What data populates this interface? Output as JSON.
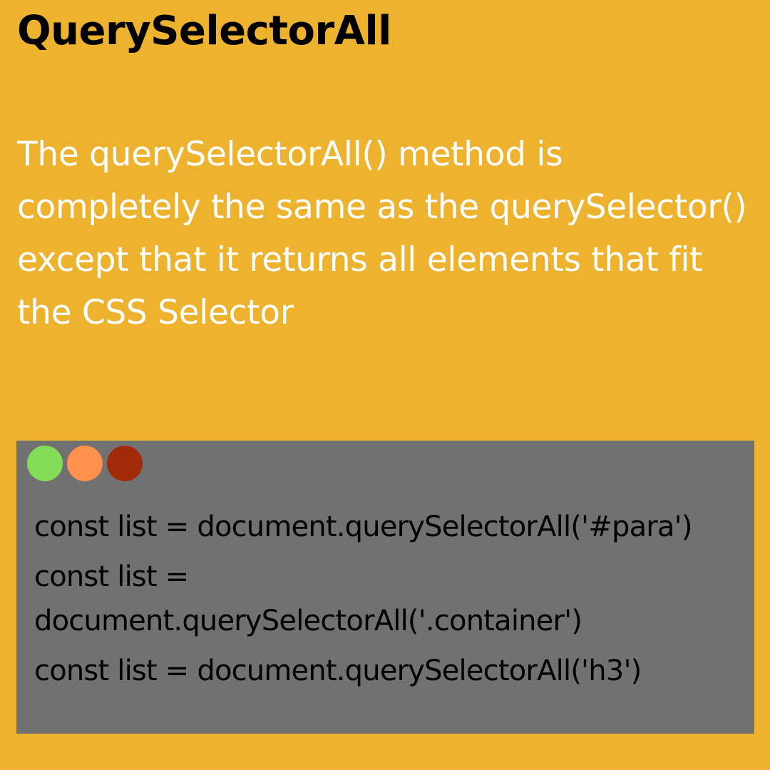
{
  "title": "QuerySelectorAll",
  "description": "The querySelectorAll() method is completely the same as the querySelector() except that it returns all elements that fit the CSS Selector",
  "colors": {
    "background": "#EDB22E",
    "code_background": "#717171",
    "dot_green": "#84DC58",
    "dot_orange": "#FF914D",
    "dot_red": "#A12A08"
  },
  "window_controls": [
    {
      "name": "green-dot-icon",
      "color": "#84DC58"
    },
    {
      "name": "orange-dot-icon",
      "color": "#FF914D"
    },
    {
      "name": "red-dot-icon",
      "color": "#A12A08"
    }
  ],
  "code_lines": [
    "const list = document.querySelectorAll('#para')",
    "const list = document.querySelectorAll('.container')",
    "const list = document.querySelectorAll('h3')"
  ]
}
